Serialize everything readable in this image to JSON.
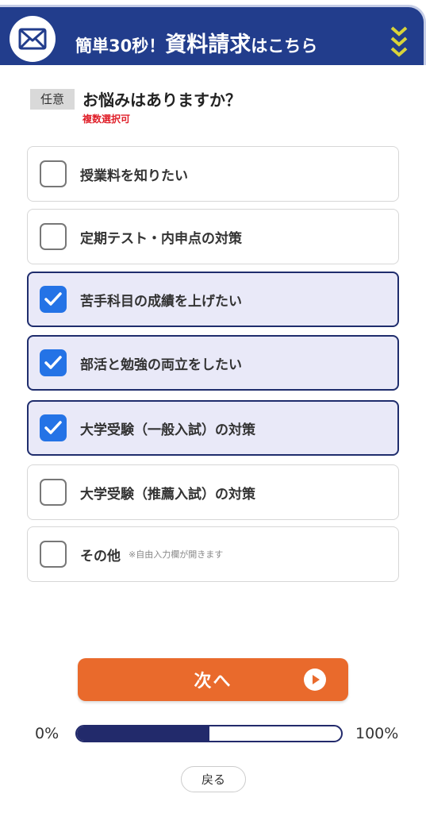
{
  "header": {
    "prefix": "簡単30秒！",
    "main": "資料請求",
    "suffix": "はこちら",
    "icon": "mail-icon",
    "colors": {
      "bar": "#223d8c",
      "chevron": "#d8d33a"
    }
  },
  "question": {
    "tag": "任意",
    "title": "お悩みはありますか？",
    "note": "複数選択可"
  },
  "options": [
    {
      "label": "授業料を知りたい",
      "checked": false
    },
    {
      "label": "定期テスト・内申点の対策",
      "checked": false
    },
    {
      "label": "苦手科目の成績を上げたい",
      "checked": true
    },
    {
      "label": "部活と勉強の両立をしたい",
      "checked": true
    },
    {
      "label": "大学受験（一般入試）の対策",
      "checked": true
    },
    {
      "label": "大学受験（推薦入試）の対策",
      "checked": false
    },
    {
      "label": "その他",
      "note": "※自由入力欄が開きます",
      "checked": false
    }
  ],
  "next_button": {
    "label": "次へ",
    "icon": "play-circle-icon",
    "color": "#e96a2c"
  },
  "progress": {
    "start_label": "0%",
    "end_label": "100%",
    "value": 0.5,
    "color": "#222a6b"
  },
  "back_button": {
    "label": "戻る"
  },
  "colors": {
    "checked_bg": "#e9e9f8",
    "checkbox_blue": "#2473e6",
    "note_red": "#e0202a"
  }
}
